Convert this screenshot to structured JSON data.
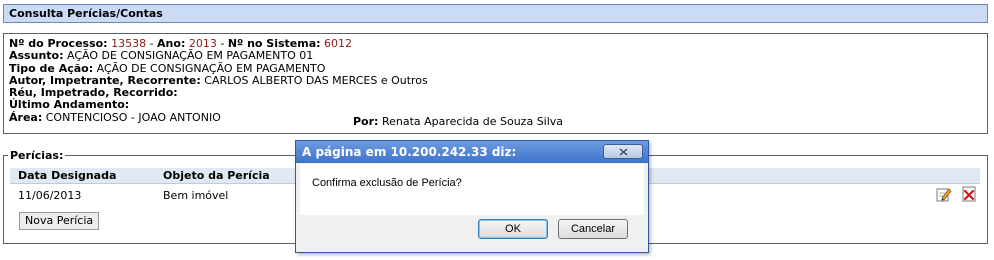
{
  "header": {
    "title": "Consulta Perícias/Contas"
  },
  "process": {
    "processo_label": "Nº do Processo:",
    "processo_value": "13538",
    "ano_label": "Ano:",
    "ano_value": "2013",
    "sistema_label": "Nº no Sistema:",
    "sistema_value": "6012",
    "assunto_label": "Assunto:",
    "assunto_value": "AÇÃO DE CONSIGNAÇÃO EM PAGAMENTO 01",
    "tipo_label": "Tipo de Ação:",
    "tipo_value": "AÇÃO DE CONSIGNAÇÃO EM PAGAMENTO",
    "autor_label": "Autor, Impetrante, Recorrente:",
    "autor_value": "CARLOS ALBERTO DAS MERCES e Outros",
    "reu_label": "Réu, Impetrado, Recorrido:",
    "reu_value": "",
    "andamento_label": "Último Andamento:",
    "andamento_value": "",
    "area_label": "Área:",
    "area_value": "CONTENCIOSO - JOAO ANTONIO",
    "por_label": "Por:",
    "por_value": "Renata Aparecida de Souza Silva"
  },
  "pericias": {
    "legend": "Perícias:",
    "columns": [
      "Data Designada",
      "Objeto da Perícia"
    ],
    "rows": [
      {
        "data": "11/06/2013",
        "objeto": "Bem imóvel"
      }
    ],
    "new_button": "Nova Perícia",
    "icons": {
      "edit": "edit-icon",
      "delete": "delete-icon"
    }
  },
  "dialog": {
    "title": "A página em 10.200.242.33 diz:",
    "message": "Confirma exclusão de Perícia?",
    "ok": "OK",
    "cancel": "Cancelar"
  },
  "colors": {
    "header_bg": "#c9dbf5",
    "value_red": "#8b1a1a",
    "dialog_title_bg": "#4f83d3"
  }
}
